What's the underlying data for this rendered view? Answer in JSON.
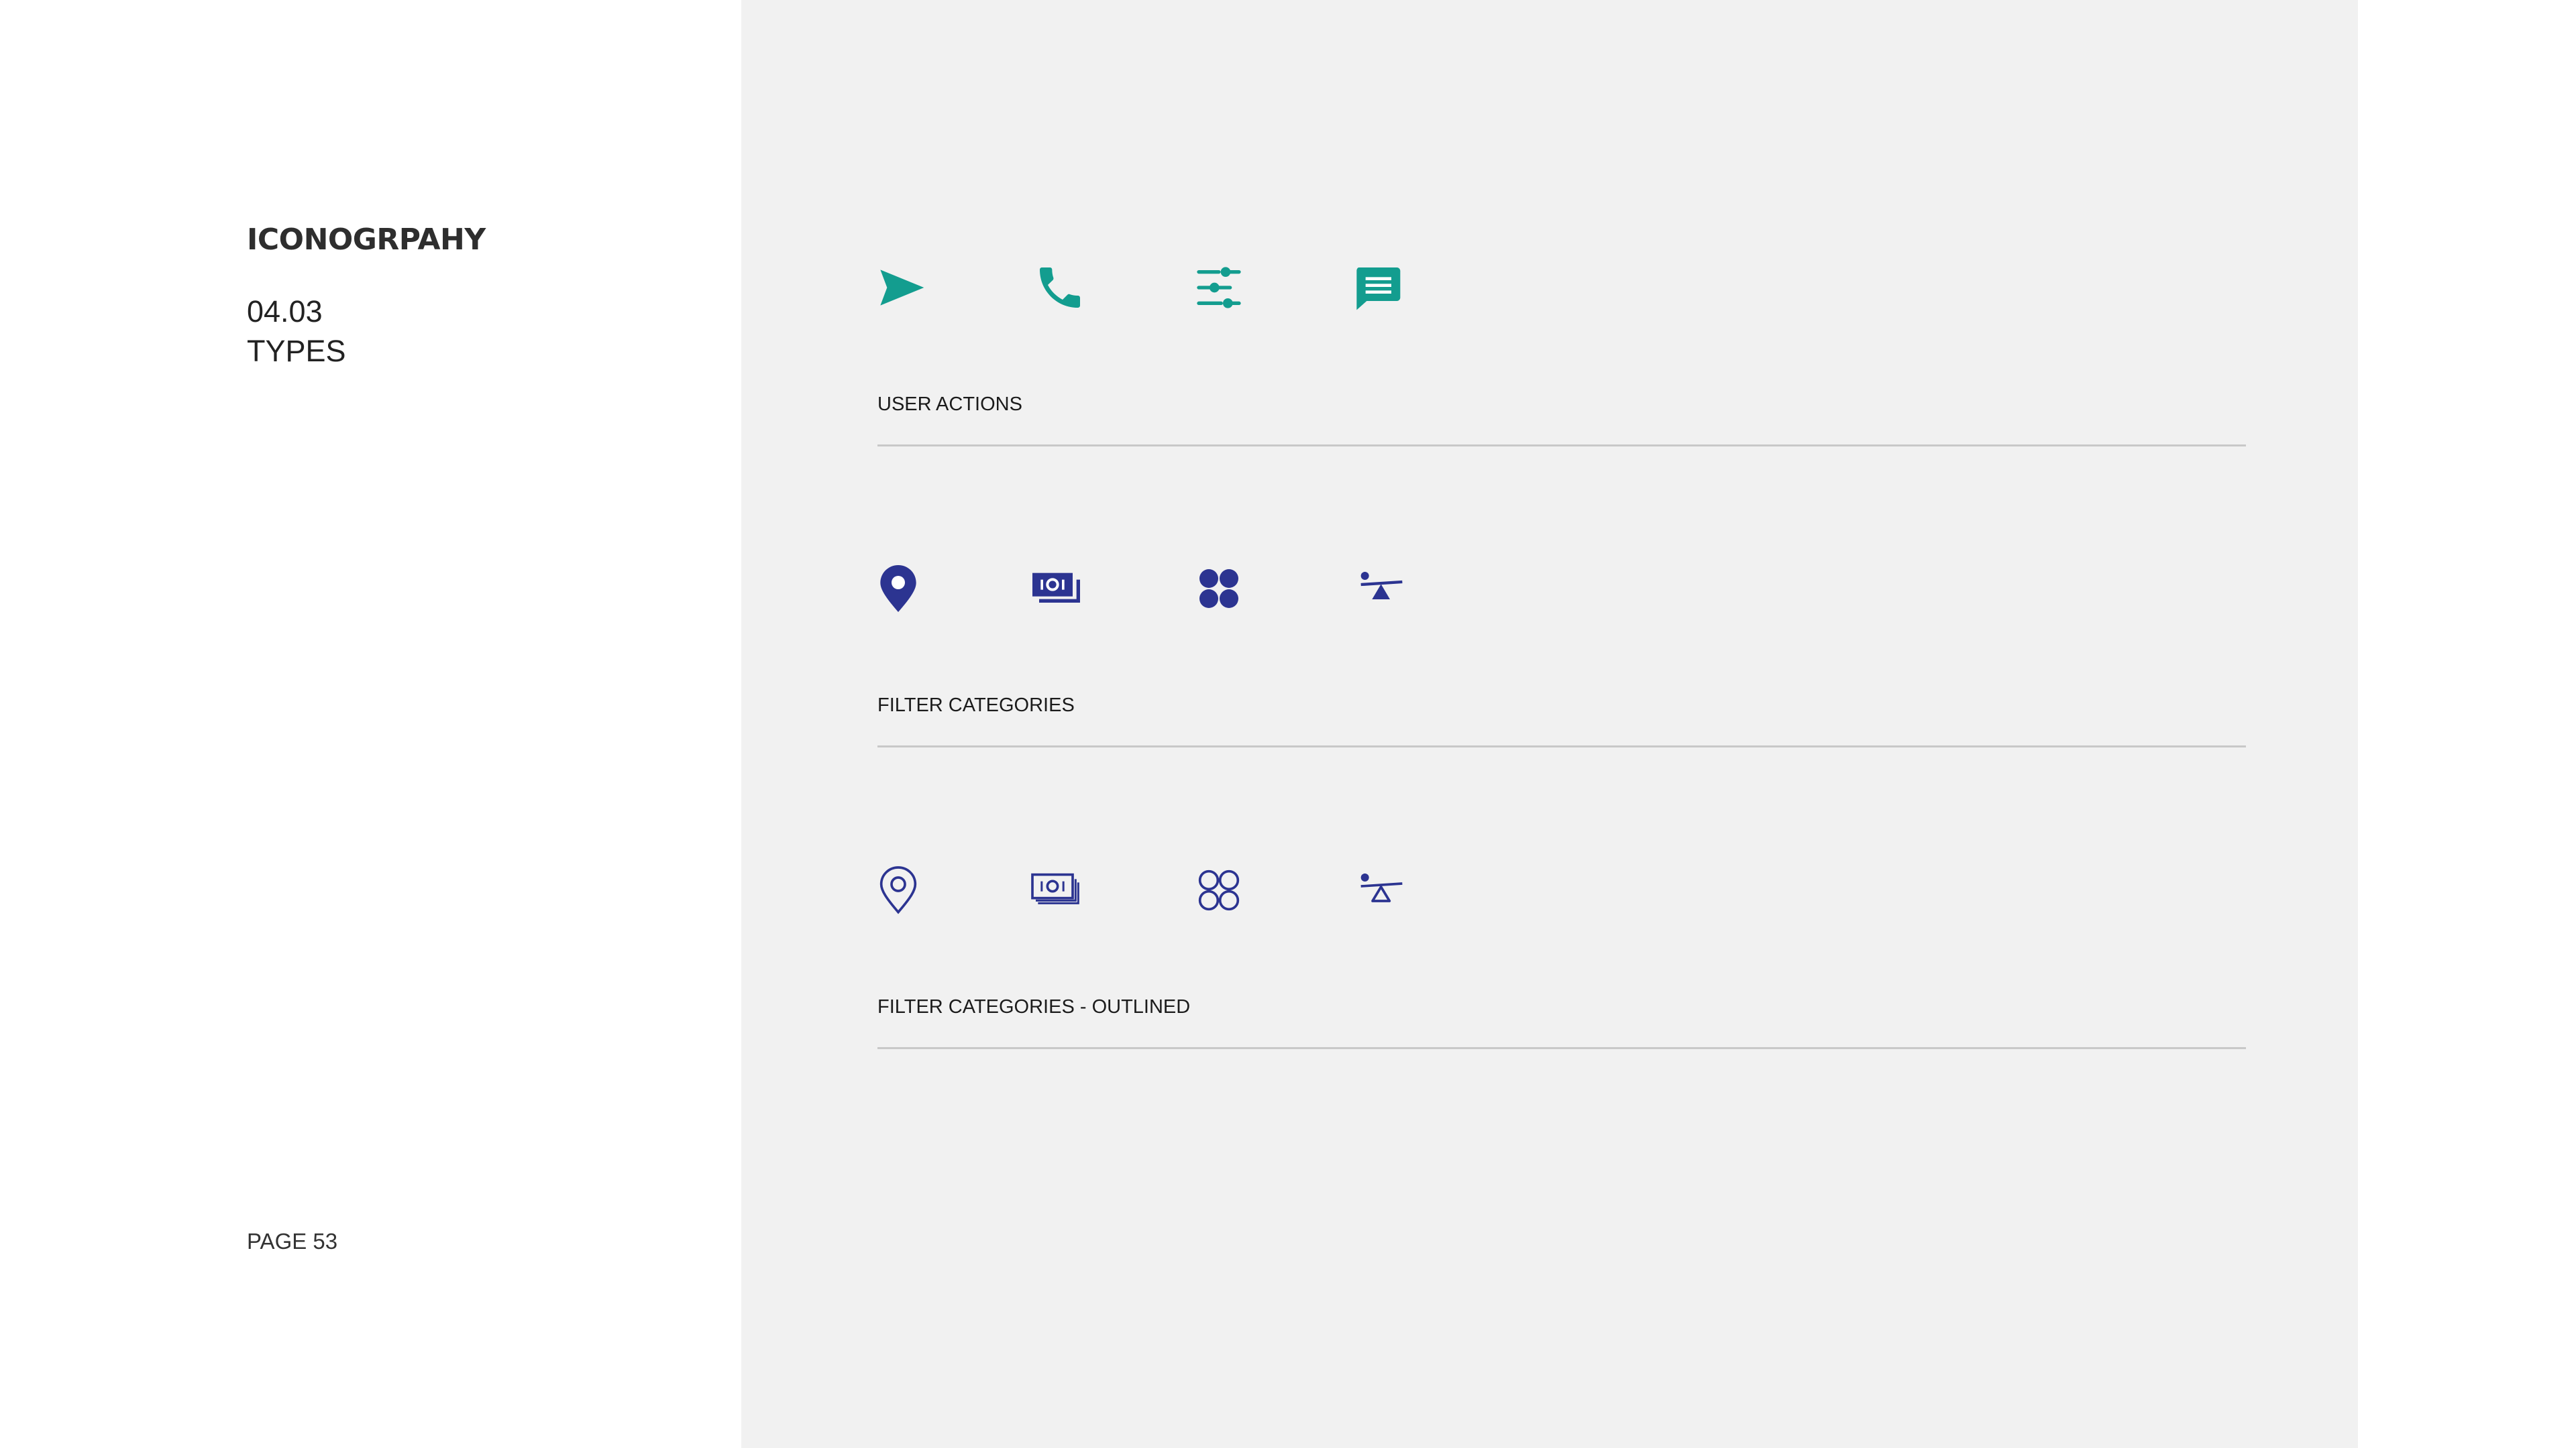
{
  "header": {
    "title": "ICONOGRPAHY",
    "section_number": "04.03",
    "section_subtitle": "TYPES"
  },
  "footer": {
    "page_number": "PAGE 53"
  },
  "colors": {
    "teal_accent": "#139d8f",
    "navy_brand": "#2c3491",
    "panel_background": "#f1f1f1",
    "divider": "#c8c8c8"
  },
  "groups": [
    {
      "label": "USER ACTIONS",
      "style": "filled",
      "color": "#139d8f",
      "icons": [
        "send-icon",
        "phone-icon",
        "sliders-icon",
        "message-icon"
      ]
    },
    {
      "label": "FILTER CATEGORIES",
      "style": "filled",
      "color": "#2c3491",
      "icons": [
        "location-pin-icon",
        "money-icon",
        "categories-icon",
        "balance-icon"
      ]
    },
    {
      "label": "FILTER CATEGORIES - OUTLINED",
      "style": "outlined",
      "color": "#2c3491",
      "icons": [
        "location-pin-outline-icon",
        "money-outline-icon",
        "categories-outline-icon",
        "balance-outline-icon"
      ]
    }
  ]
}
